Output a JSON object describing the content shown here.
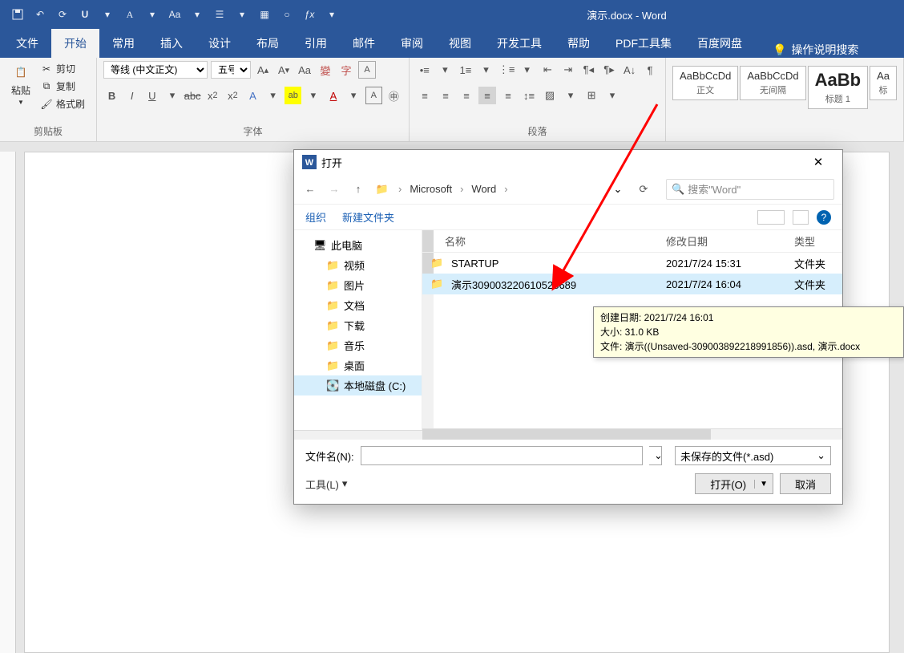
{
  "app": {
    "title": "演示.docx - Word"
  },
  "qat": [
    "save",
    "undo",
    "redo"
  ],
  "ribbon": {
    "tabs": [
      "文件",
      "开始",
      "常用",
      "插入",
      "设计",
      "布局",
      "引用",
      "邮件",
      "审阅",
      "视图",
      "开发工具",
      "帮助",
      "PDF工具集",
      "百度网盘"
    ],
    "active": 1,
    "help_search": "操作说明搜索"
  },
  "clipboard": {
    "label": "剪贴板",
    "paste": "粘贴",
    "cut": "剪切",
    "copy": "复制",
    "format_painter": "格式刷"
  },
  "font": {
    "label": "字体",
    "family": "等线 (中文正文)",
    "size": "五号"
  },
  "paragraph": {
    "label": "段落"
  },
  "styles": [
    {
      "preview": "AaBbCcDd",
      "name": "正文",
      "big": false
    },
    {
      "preview": "AaBbCcDd",
      "name": "无间隔",
      "big": false
    },
    {
      "preview": "AaBb",
      "name": "标题 1",
      "big": true
    },
    {
      "preview": "Aa",
      "name": "标",
      "big": false
    }
  ],
  "dialog": {
    "title": "打开",
    "crumbs": [
      "Microsoft",
      "Word"
    ],
    "search_placeholder": "搜索\"Word\"",
    "toolbar": {
      "organize": "组织",
      "new_folder": "新建文件夹"
    },
    "tree": [
      {
        "icon": "pc",
        "label": "此电脑"
      },
      {
        "icon": "folder",
        "label": "视频"
      },
      {
        "icon": "folder",
        "label": "图片"
      },
      {
        "icon": "folder",
        "label": "文档"
      },
      {
        "icon": "folder",
        "label": "下载"
      },
      {
        "icon": "folder",
        "label": "音乐"
      },
      {
        "icon": "folder",
        "label": "桌面"
      },
      {
        "icon": "drive",
        "label": "本地磁盘 (C:)",
        "selected": true
      }
    ],
    "columns": {
      "name": "名称",
      "date": "修改日期",
      "type": "类型"
    },
    "files": [
      {
        "name": "STARTUP",
        "date": "2021/7/24 15:31",
        "type": "文件夹",
        "selected": false
      },
      {
        "name": "演示309003220610528689",
        "date": "2021/7/24 16:04",
        "type": "文件夹",
        "selected": true
      }
    ],
    "tooltip": {
      "line1": "创建日期: 2021/7/24 16:01",
      "line2": "大小: 31.0 KB",
      "line3": "文件: 演示((Unsaved-309003892218991856)).asd, 演示.docx"
    },
    "footer": {
      "filename_label": "文件名(N):",
      "filter": "未保存的文件(*.asd)",
      "tools": "工具(L)",
      "open": "打开(O)",
      "cancel": "取消"
    }
  }
}
